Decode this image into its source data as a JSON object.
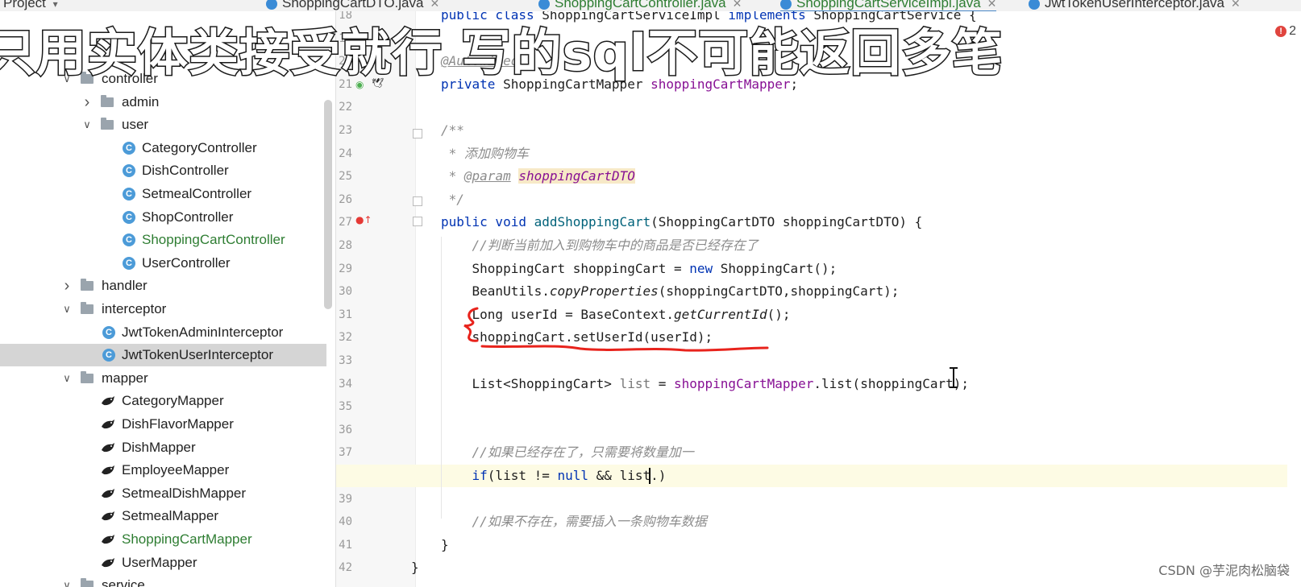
{
  "tabs": [
    {
      "label": "ShoppingCartDTO.java",
      "visible_label": "ShoppingCartDTO.java",
      "active": false,
      "green": false
    },
    {
      "label": "ShoppingCartController.java",
      "active": false,
      "green": true
    },
    {
      "label": "ShoppingCartServiceImpl.java",
      "active": true,
      "green": true
    },
    {
      "label": "JwtTokenUserInterceptor.java",
      "active": false,
      "green": false
    }
  ],
  "project_label": "Project",
  "subtitle": "只用实体类接受就行  写的sql不可能返回多笔",
  "error_count": "2",
  "tree": [
    {
      "label": "controller",
      "kind": "folder",
      "expanded": true,
      "indent": 1
    },
    {
      "label": "admin",
      "kind": "folder",
      "expanded": false,
      "indent": 2
    },
    {
      "label": "user",
      "kind": "folder",
      "expanded": true,
      "indent": 2
    },
    {
      "label": "CategoryController",
      "kind": "class",
      "indent": 3
    },
    {
      "label": "DishController",
      "kind": "class",
      "indent": 3
    },
    {
      "label": "SetmealController",
      "kind": "class",
      "indent": 3
    },
    {
      "label": "ShopController",
      "kind": "class",
      "indent": 3
    },
    {
      "label": "ShoppingCartController",
      "kind": "class",
      "indent": 3,
      "green": true
    },
    {
      "label": "UserController",
      "kind": "class",
      "indent": 3
    },
    {
      "label": "handler",
      "kind": "folder",
      "expanded": false,
      "indent": 1
    },
    {
      "label": "interceptor",
      "kind": "folder",
      "expanded": true,
      "indent": 1
    },
    {
      "label": "JwtTokenAdminInterceptor",
      "kind": "class",
      "indent": 2
    },
    {
      "label": "JwtTokenUserInterceptor",
      "kind": "class",
      "indent": 2,
      "selected": true
    },
    {
      "label": "mapper",
      "kind": "folder",
      "expanded": true,
      "indent": 1
    },
    {
      "label": "CategoryMapper",
      "kind": "mapper",
      "indent": 2
    },
    {
      "label": "DishFlavorMapper",
      "kind": "mapper",
      "indent": 2
    },
    {
      "label": "DishMapper",
      "kind": "mapper",
      "indent": 2
    },
    {
      "label": "EmployeeMapper",
      "kind": "mapper",
      "indent": 2
    },
    {
      "label": "SetmealDishMapper",
      "kind": "mapper",
      "indent": 2
    },
    {
      "label": "SetmealMapper",
      "kind": "mapper",
      "indent": 2
    },
    {
      "label": "ShoppingCartMapper",
      "kind": "mapper",
      "indent": 2,
      "green": true
    },
    {
      "label": "UserMapper",
      "kind": "mapper",
      "indent": 2
    },
    {
      "label": "service",
      "kind": "folder",
      "expanded": true,
      "indent": 1
    }
  ],
  "code_lines": [
    {
      "n": "18",
      "segs": [
        [
          "kw",
          "public class "
        ],
        [
          "",
          "ShoppingCartServiceImpl "
        ],
        [
          "kw",
          "implements "
        ],
        [
          "",
          "ShoppingCartService {"
        ]
      ]
    },
    {
      "n": "19",
      "segs": []
    },
    {
      "n": "20",
      "segs": [
        [
          "tag",
          "@Autowired"
        ]
      ]
    },
    {
      "n": "21",
      "segs": [
        [
          "kw",
          "private "
        ],
        [
          "",
          "ShoppingCartMapper "
        ],
        [
          "fld",
          "shoppingCartMapper"
        ],
        [
          "",
          ";"
        ]
      ]
    },
    {
      "n": "22",
      "segs": []
    },
    {
      "n": "23",
      "segs": [
        [
          "cmt",
          "/**"
        ]
      ]
    },
    {
      "n": "24",
      "segs": [
        [
          "cmt",
          " * 添加购物车"
        ]
      ]
    },
    {
      "n": "25",
      "segs": [
        [
          "cmt",
          " * "
        ],
        [
          "tag",
          "@param"
        ],
        [
          "cmt",
          " "
        ],
        [
          "hl",
          "shoppingCartDTO"
        ]
      ]
    },
    {
      "n": "26",
      "segs": [
        [
          "cmt",
          " */"
        ]
      ]
    },
    {
      "n": "27",
      "segs": [
        [
          "kw",
          "public void "
        ],
        [
          "mth",
          "addShoppingCart"
        ],
        [
          "",
          "(ShoppingCartDTO shoppingCartDTO) {"
        ]
      ]
    },
    {
      "n": "28",
      "segs": [
        [
          "cmt",
          "    //判断当前加入到购物车中的商品是否已经存在了"
        ]
      ]
    },
    {
      "n": "29",
      "segs": [
        [
          "",
          "    ShoppingCart shoppingCart = "
        ],
        [
          "kw",
          "new "
        ],
        [
          "",
          "ShoppingCart();"
        ]
      ]
    },
    {
      "n": "30",
      "segs": [
        [
          "",
          "    BeanUtils."
        ],
        [
          "ital",
          "copyProperties"
        ],
        [
          "",
          "(shoppingCartDTO,shoppingCart);"
        ]
      ]
    },
    {
      "n": "31",
      "segs": [
        [
          "",
          "    Long userId = BaseContext."
        ],
        [
          "ital",
          "getCurrentId"
        ],
        [
          "",
          "();"
        ]
      ]
    },
    {
      "n": "32",
      "segs": [
        [
          "",
          "    shoppingCart.setUserId(userId);"
        ]
      ]
    },
    {
      "n": "33",
      "segs": []
    },
    {
      "n": "34",
      "segs": [
        [
          "",
          "    List<ShoppingCart> "
        ],
        [
          "var",
          "list"
        ],
        [
          "",
          " = "
        ],
        [
          "fld",
          "shoppingCartMapper"
        ],
        [
          "",
          ".list(shoppingCart);"
        ]
      ]
    },
    {
      "n": "35",
      "segs": []
    },
    {
      "n": "36",
      "segs": []
    },
    {
      "n": "37",
      "segs": [
        [
          "cmt",
          "    //如果已经存在了，只需要将数量加一"
        ]
      ]
    },
    {
      "n": "38",
      "segs": [
        [
          "",
          "    "
        ],
        [
          "kw",
          "if"
        ],
        [
          "",
          "(list != "
        ],
        [
          "kw",
          "null "
        ],
        [
          "",
          "&& list.)"
        ]
      ],
      "current": true
    },
    {
      "n": "39",
      "segs": []
    },
    {
      "n": "40",
      "segs": [
        [
          "cmt",
          "    //如果不存在，需要插入一条购物车数据"
        ]
      ]
    },
    {
      "n": "41",
      "segs": [
        [
          "",
          "}"
        ]
      ]
    },
    {
      "n": "42",
      "segs": [
        [
          "",
          "}"
        ]
      ],
      "outdent": true
    }
  ],
  "watermark": "CSDN @芋泥肉松脑袋",
  "colors": {
    "annotation": "#e8231c",
    "accent": "#4a88c7",
    "green_file": "#2e7d32"
  }
}
